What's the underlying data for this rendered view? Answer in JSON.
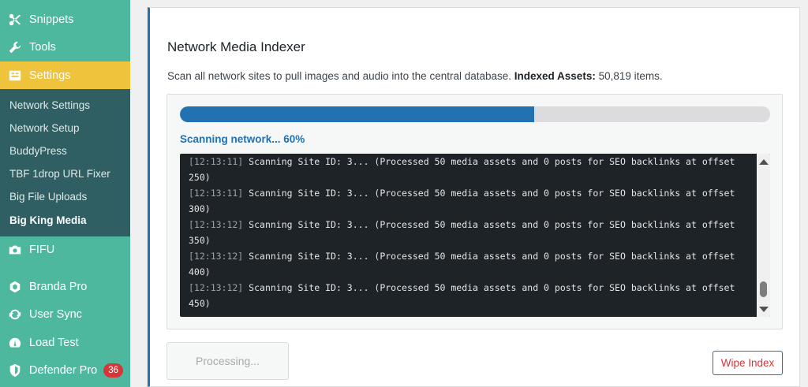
{
  "sidebar": {
    "top_items": [
      {
        "label": "Snippets",
        "icon": "scissors-icon"
      },
      {
        "label": "Tools",
        "icon": "wrench-icon"
      },
      {
        "label": "Settings",
        "icon": "settings-icon"
      }
    ],
    "submenu": [
      "Network Settings",
      "Network Setup",
      "BuddyPress",
      "TBF 1drop URL Fixer",
      "Big File Uploads",
      "Big King Media"
    ],
    "bottom_items": [
      {
        "label": "FIFU",
        "icon": "camera-icon"
      },
      {
        "label": "Branda Pro",
        "icon": "branda-icon"
      },
      {
        "label": "User Sync",
        "icon": "sync-icon"
      },
      {
        "label": "Load Test",
        "icon": "gauge-icon"
      },
      {
        "label": "Defender Pro",
        "icon": "shield-icon",
        "badge": "36"
      }
    ],
    "colors": {
      "bg": "#4eb89e",
      "active": "#f0c33c",
      "submenu": "#2f5f63"
    }
  },
  "main": {
    "title": "Network Media Indexer",
    "description": "Scan all network sites to pull images and audio into the central database.",
    "indexed_label": "Indexed Assets:",
    "indexed_value": "50,819 items.",
    "progress": 0.6,
    "status": "Scanning network... 60%",
    "log": [
      {
        "time": "[12:13:11]",
        "text": "Scanning Site ID: 3... (Processed 50 media assets and 0 posts for SEO backlinks at offset 250)"
      },
      {
        "time": "[12:13:11]",
        "text": "Scanning Site ID: 3... (Processed 50 media assets and 0 posts for SEO backlinks at offset 300)"
      },
      {
        "time": "[12:13:12]",
        "text": "Scanning Site ID: 3... (Processed 50 media assets and 0 posts for SEO backlinks at offset 350)"
      },
      {
        "time": "[12:13:12]",
        "text": "Scanning Site ID: 3... (Processed 50 media assets and 0 posts for SEO backlinks at offset 400)"
      },
      {
        "time": "[12:13:12]",
        "text": "Scanning Site ID: 3... (Processed 50 media assets and 0 posts for SEO backlinks at offset 450)"
      }
    ],
    "processing_label": "Processing...",
    "wipe_label": "Wipe Index",
    "colors": {
      "accent": "#2271b1",
      "danger": "#d63638"
    }
  }
}
